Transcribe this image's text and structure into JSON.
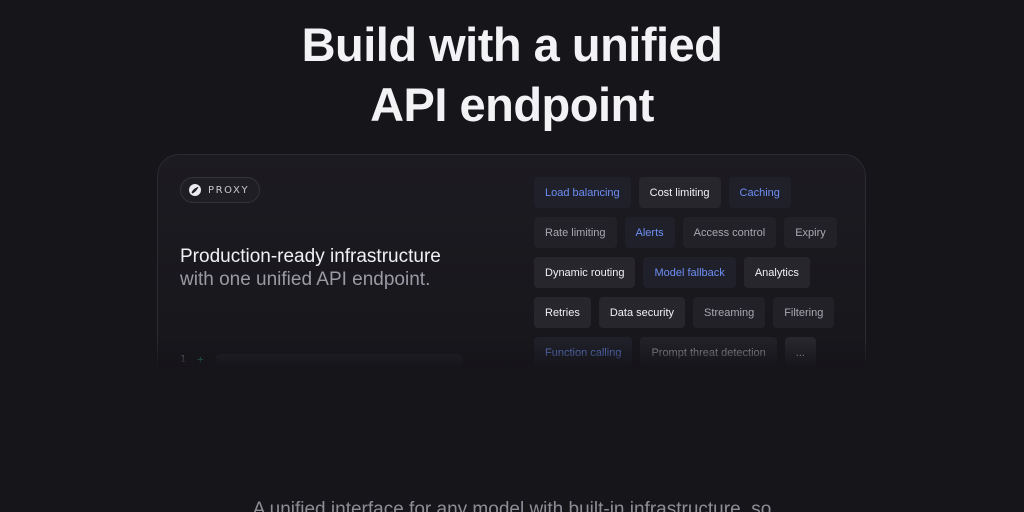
{
  "hero": {
    "title_line1": "Build with a unified",
    "title_line2": "API endpoint"
  },
  "card": {
    "badge_label": "PROXY",
    "badge_icon": "proxy-logo-icon",
    "headline_strong": "Production-ready infrastructure",
    "headline_muted": "with one unified API endpoint.",
    "code": {
      "line_number": "1",
      "diff_marker": "+"
    }
  },
  "features": [
    [
      {
        "label": "Load balancing",
        "style": "accent"
      },
      {
        "label": "Cost limiting",
        "style": "bright"
      },
      {
        "label": "Caching",
        "style": "accent"
      }
    ],
    [
      {
        "label": "Rate limiting",
        "style": "dim"
      },
      {
        "label": "Alerts",
        "style": "accent"
      },
      {
        "label": "Access control",
        "style": "dim"
      },
      {
        "label": "Expiry",
        "style": "dim"
      }
    ],
    [
      {
        "label": "Dynamic routing",
        "style": "bright"
      },
      {
        "label": "Model fallback",
        "style": "accent"
      },
      {
        "label": "Analytics",
        "style": "bright"
      }
    ],
    [
      {
        "label": "Retries",
        "style": "bright"
      },
      {
        "label": "Data security",
        "style": "bright"
      },
      {
        "label": "Streaming",
        "style": "dim"
      },
      {
        "label": "Filtering",
        "style": "dim"
      }
    ],
    [
      {
        "label": "Function calling",
        "style": "accent"
      },
      {
        "label": "Prompt threat detection",
        "style": "dim"
      },
      {
        "label": "...",
        "style": "bright"
      }
    ]
  ],
  "footer": {
    "text": "A unified interface for any model with built-in infrastructure, so"
  },
  "colors": {
    "background": "#16151a",
    "accent": "#6e8ff5",
    "diff_green": "#3ccf8e"
  }
}
